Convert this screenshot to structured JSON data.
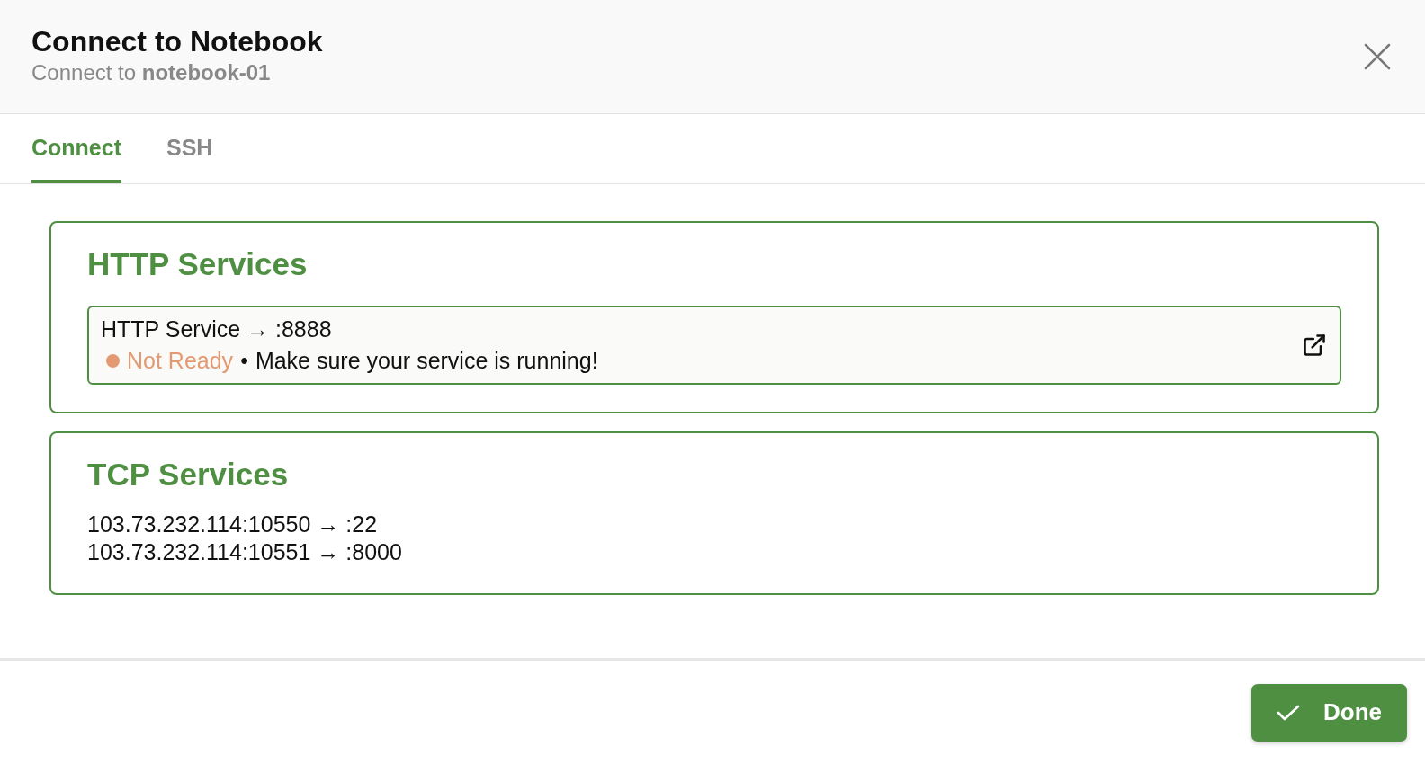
{
  "dialog": {
    "title": "Connect to Notebook",
    "subtitle": "Connect to **notebook-01**"
  },
  "tabs": [
    {
      "label": "Connect",
      "selected": true
    },
    {
      "label": "SSH",
      "selected": false
    }
  ],
  "http_services": {
    "heading": "HTTP Services",
    "items": [
      {
        "name": "HTTP Service → :8888",
        "status": "Not Ready",
        "color": "#e39a72",
        "separator": "•",
        "message": "Make sure your service is running!"
      }
    ]
  },
  "tcp_services": {
    "heading": "TCP Services",
    "items": [
      "103.73.232.114:10550 → :22",
      "103.73.232.114:10551 → :8000"
    ]
  },
  "footer": {
    "done_button": "Done"
  }
}
